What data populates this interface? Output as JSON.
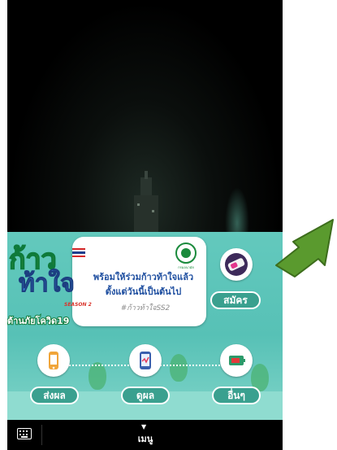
{
  "banner": {
    "logo_title": "ก้าว",
    "logo_title2": "ท้าใจ",
    "season": "SEASON 2",
    "subtitle": "ต้านภัยโควิด19",
    "headline1": "พร้อมให้ร่วมก้าวท้าใจแล้ว",
    "headline2": "ตั้งแต่วันนี้เป็นต้นไป",
    "hashtag": "#ก้าวท้าใจSS2",
    "moph_caption": "กรมอนามัย"
  },
  "actions": {
    "register": "สมัคร",
    "send_result": "ส่งผล",
    "view_result": "ดูผล",
    "others": "อื่นๆ"
  },
  "bottom_bar": {
    "menu_label": "เมนู",
    "menu_arrow": "▼",
    "keyboard_icon": "keyboard-icon"
  },
  "colors": {
    "banner_bg": "#5fc6ba",
    "pill": "#3aa08f",
    "arrow": "#5a9a2e"
  }
}
